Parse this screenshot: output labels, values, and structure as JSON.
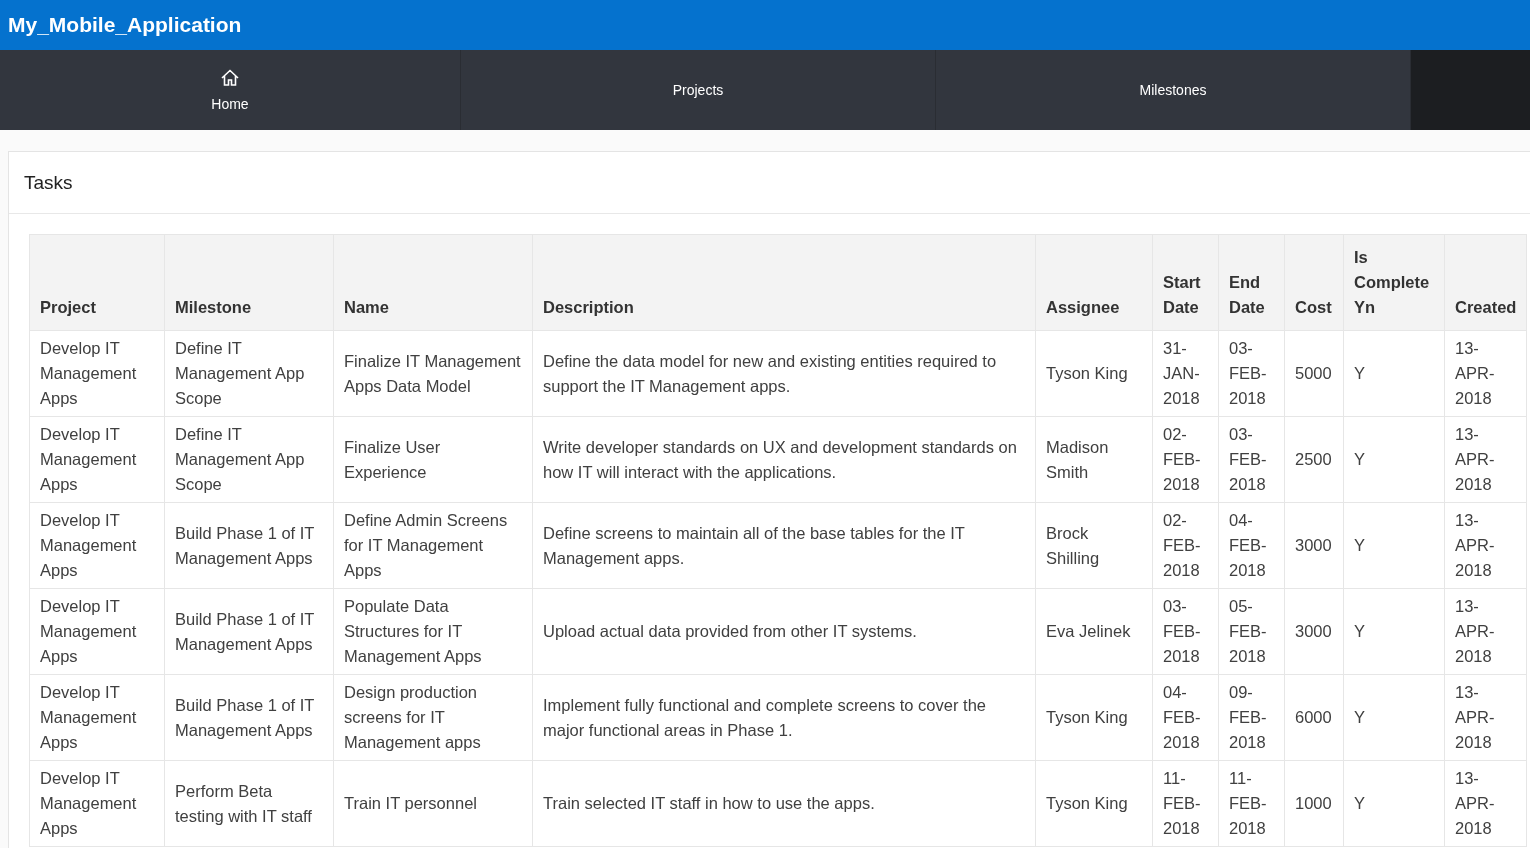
{
  "app_title": "My_Mobile_Application",
  "nav": [
    {
      "label": "Home",
      "kind": "icon"
    },
    {
      "label": "Projects",
      "kind": "text"
    },
    {
      "label": "Milestones",
      "kind": "text"
    }
  ],
  "panel": {
    "title": "Tasks"
  },
  "table": {
    "columns": [
      "Project",
      "Milestone",
      "Name",
      "Description",
      "Assignee",
      "Start Date",
      "End Date",
      "Cost",
      "Is Complete Yn",
      "Created"
    ],
    "rows": [
      [
        "Develop IT Management Apps",
        "Define IT Management App Scope",
        "Finalize IT Management Apps Data Model",
        "Define the data model for new and existing entities required to support the IT Management apps.",
        "Tyson King",
        "31-JAN-2018",
        "03-FEB-2018",
        "5000",
        "Y",
        "13-APR-2018"
      ],
      [
        "Develop IT Management Apps",
        "Define IT Management App Scope",
        "Finalize User Experience",
        "Write developer standards on UX and development standards on how IT will interact with the applications.",
        "Madison Smith",
        "02-FEB-2018",
        "03-FEB-2018",
        "2500",
        "Y",
        "13-APR-2018"
      ],
      [
        "Develop IT Management Apps",
        "Build Phase 1 of IT Management Apps",
        "Define Admin Screens for IT Management Apps",
        "Define screens to maintain all of the base tables for the IT Management apps.",
        "Brock Shilling",
        "02-FEB-2018",
        "04-FEB-2018",
        "3000",
        "Y",
        "13-APR-2018"
      ],
      [
        "Develop IT Management Apps",
        "Build Phase 1 of IT Management Apps",
        "Populate Data Structures for IT Management Apps",
        "Upload actual data provided from other IT systems.",
        "Eva Jelinek",
        "03-FEB-2018",
        "05-FEB-2018",
        "3000",
        "Y",
        "13-APR-2018"
      ],
      [
        "Develop IT Management Apps",
        "Build Phase 1 of IT Management Apps",
        "Design production screens for IT Management apps",
        "Implement fully functional and complete screens to cover the major functional areas in Phase 1.",
        "Tyson King",
        "04-FEB-2018",
        "09-FEB-2018",
        "6000",
        "Y",
        "13-APR-2018"
      ],
      [
        "Develop IT Management Apps",
        "Perform Beta testing with IT staff",
        "Train IT personnel",
        "Train selected IT staff in how to use the apps.",
        "Tyson King",
        "11-FEB-2018",
        "11-FEB-2018",
        "1000",
        "Y",
        "13-APR-2018"
      ]
    ]
  }
}
